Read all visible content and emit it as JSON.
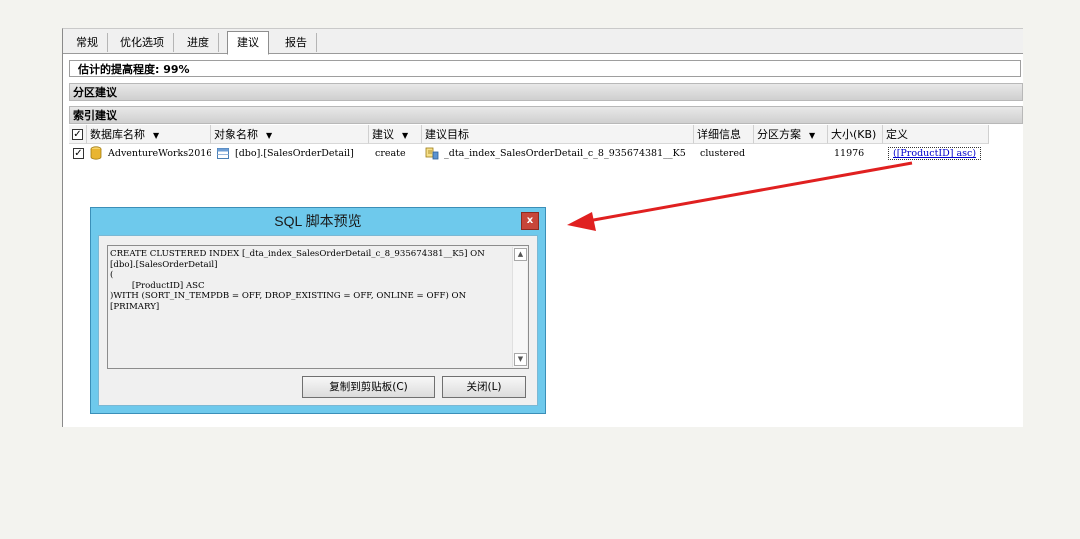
{
  "tabs": [
    {
      "label": "常规"
    },
    {
      "label": "优化选项"
    },
    {
      "label": "进度"
    },
    {
      "label": "建议"
    },
    {
      "label": "报告"
    }
  ],
  "estimate": "估计的提高程度: 99%",
  "sections": {
    "partition": "分区建议",
    "index": "索引建议"
  },
  "grid": {
    "headers": [
      "数据库名称",
      "对象名称",
      "建议",
      "建议目标",
      "详细信息",
      "分区方案",
      "大小(KB)",
      "定义"
    ],
    "row": {
      "database": "AdventureWorks2016",
      "object": "[dbo].[SalesOrderDetail]",
      "action": "create",
      "target": "_dta_index_SalesOrderDetail_c_8_935674381__K5",
      "detail": "clustered",
      "partition": "",
      "size": "11976",
      "definition": "([ProductID] asc)"
    }
  },
  "dialog": {
    "title": "SQL 脚本预览",
    "close_glyph": "x",
    "sql": "CREATE CLUSTERED INDEX [_dta_index_SalesOrderDetail_c_8_935674381__K5] ON\n[dbo].[SalesOrderDetail]\n(\n        [ProductID] ASC\n)WITH (SORT_IN_TEMPDB = OFF, DROP_EXISTING = OFF, ONLINE = OFF) ON\n[PRIMARY]",
    "copy_button": "复制到剪贴板(C)",
    "close_button": "关闭(L)"
  },
  "colors": {
    "arrow": "#e02020",
    "dialog_frame": "#6ec9ec",
    "close_button": "#c7463a"
  }
}
